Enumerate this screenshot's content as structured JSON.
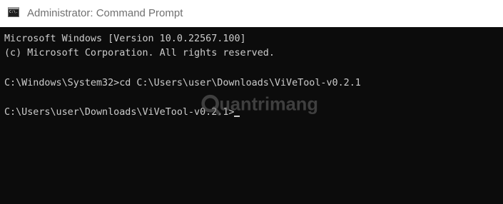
{
  "window": {
    "title": "Administrator: Command Prompt",
    "icon": "command-prompt-icon",
    "icon_text": "C:\\."
  },
  "console": {
    "lines": [
      "Microsoft Windows [Version 10.0.22567.100]",
      "(c) Microsoft Corporation. All rights reserved.",
      "C:\\Windows\\System32>cd C:\\Users\\user\\Downloads\\ViVeTool-v0.2.1",
      "C:\\Users\\user\\Downloads\\ViVeTool-v0.2.1>"
    ]
  },
  "watermark": {
    "text": "uantrimang",
    "logo": "q-logo"
  },
  "colors": {
    "titlebar_bg": "#ffffff",
    "title_text": "#707070",
    "console_bg": "#0c0c0c",
    "console_text": "#cccccc"
  }
}
